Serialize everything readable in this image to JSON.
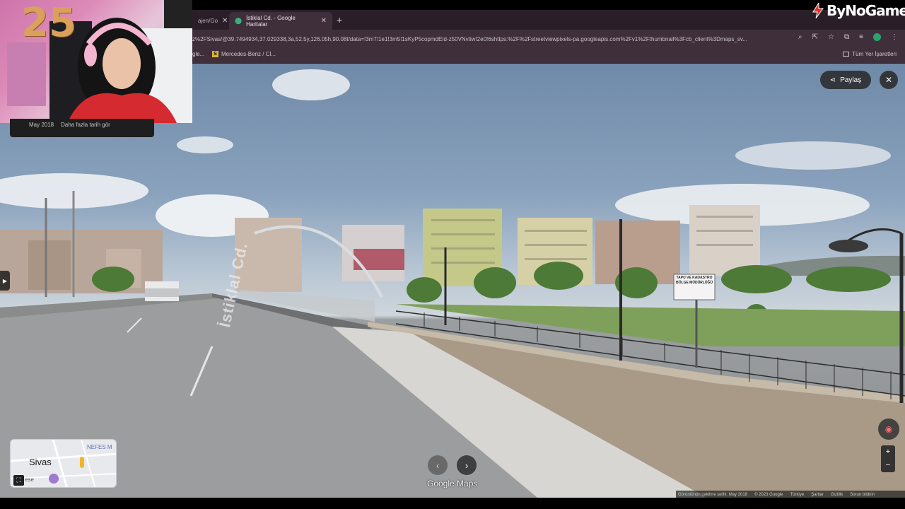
{
  "browser": {
    "tabs": [
      {
        "label": "ajen/Go",
        "active": false
      },
      {
        "label": "İstiklal Cd. - Google Haritalar",
        "active": true
      }
    ],
    "new_tab": "+",
    "url": "z%2FSivas/@39.7494934,37.029338,3a,52.5y,126.05h,90.08t/data=!3m7!1e1!3m5!1sKyP5copmdEId-z50VNvtiw!2e0!6shttps:%2F%2Fstreetviewpixels-pa.googleapis.com%2Fv1%2Fthumbnail%3Fcb_client%3Dmaps_sv...",
    "bookmarks": [
      {
        "label": "gle..."
      },
      {
        "label": "Mercedes-Benz / Cl...",
        "icon_letter": "S"
      }
    ],
    "all_bookmarks": "Tüm Yer İşaretleri"
  },
  "logo": {
    "text": "ByNoGame",
    "accent": "#e5322d"
  },
  "webcam": {
    "number": "25"
  },
  "info_card": {
    "date": "May 2018",
    "more_dates": "Daha fazla tarih gör"
  },
  "street_view": {
    "share_label": "Paylaş",
    "close_icon": "close-icon",
    "road_text": "İstiklal Cd.",
    "sign_text": "TAPU VE KADASTRO\nBÖLGE MÜDÜRLÜĞÜ",
    "google_maps_label": "Google Maps",
    "prev_arrow": "‹",
    "next_arrow": "›",
    "zoom_in": "+",
    "zoom_out": "−"
  },
  "minimap": {
    "city": "Sivas",
    "place": "NEFES M",
    "ese": "ese"
  },
  "footer": {
    "capture": "Görüntünün çekilme tarihi: May 2018",
    "copyright": "© 2023 Google",
    "links": [
      "Türkiye",
      "Şartlar",
      "Gizlilik",
      "Sorun bildirin"
    ]
  }
}
